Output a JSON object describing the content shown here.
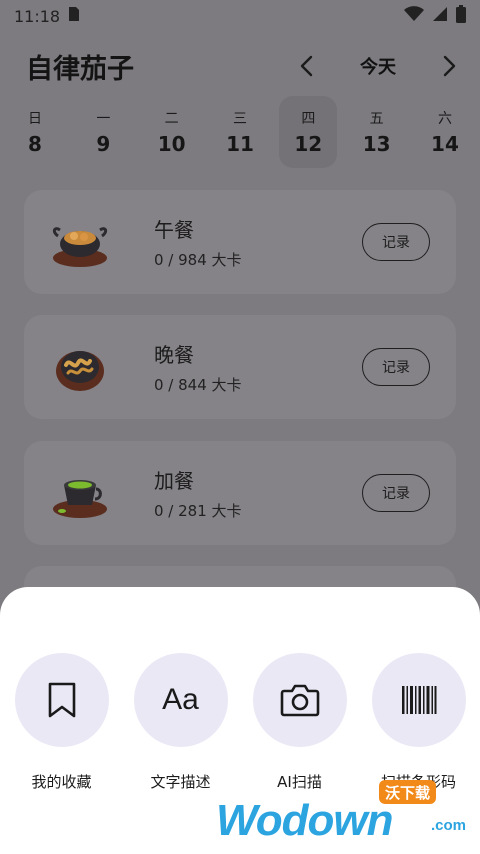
{
  "status_bar": {
    "time": "11:18"
  },
  "header": {
    "app_title": "自律茄子",
    "date_label": "今天"
  },
  "week": [
    {
      "weekday": "日",
      "date": "8",
      "selected": false
    },
    {
      "weekday": "一",
      "date": "9",
      "selected": false
    },
    {
      "weekday": "二",
      "date": "10",
      "selected": false
    },
    {
      "weekday": "三",
      "date": "11",
      "selected": false
    },
    {
      "weekday": "四",
      "date": "12",
      "selected": true
    },
    {
      "weekday": "五",
      "date": "13",
      "selected": false
    },
    {
      "weekday": "六",
      "date": "14",
      "selected": false
    }
  ],
  "meals": [
    {
      "name": "午餐",
      "calories": "0 / 984 大卡",
      "button": "记录",
      "icon": "lunch-pot-icon"
    },
    {
      "name": "晚餐",
      "calories": "0 / 844 大卡",
      "button": "记录",
      "icon": "dinner-dish-icon"
    },
    {
      "name": "加餐",
      "calories": "0 / 281 大卡",
      "button": "记录",
      "icon": "snack-cup-icon"
    }
  ],
  "sheet": {
    "actions": [
      {
        "label": "我的收藏",
        "icon": "bookmark-icon"
      },
      {
        "label": "文字描述",
        "icon": "text-aa-icon",
        "glyph": "Aa"
      },
      {
        "label": "AI扫描",
        "icon": "camera-icon"
      },
      {
        "label": "扫描条形码",
        "icon": "barcode-icon"
      }
    ]
  },
  "watermark": {
    "brand": "Wodown",
    "suffix": ".com",
    "badge": "沃下载"
  },
  "colors": {
    "scrim": "#7d7b80",
    "sheet": "#ffffff",
    "action_circle": "#ebe8f6",
    "watermark": "#2ba4e0",
    "badge": "#f28a1a"
  }
}
